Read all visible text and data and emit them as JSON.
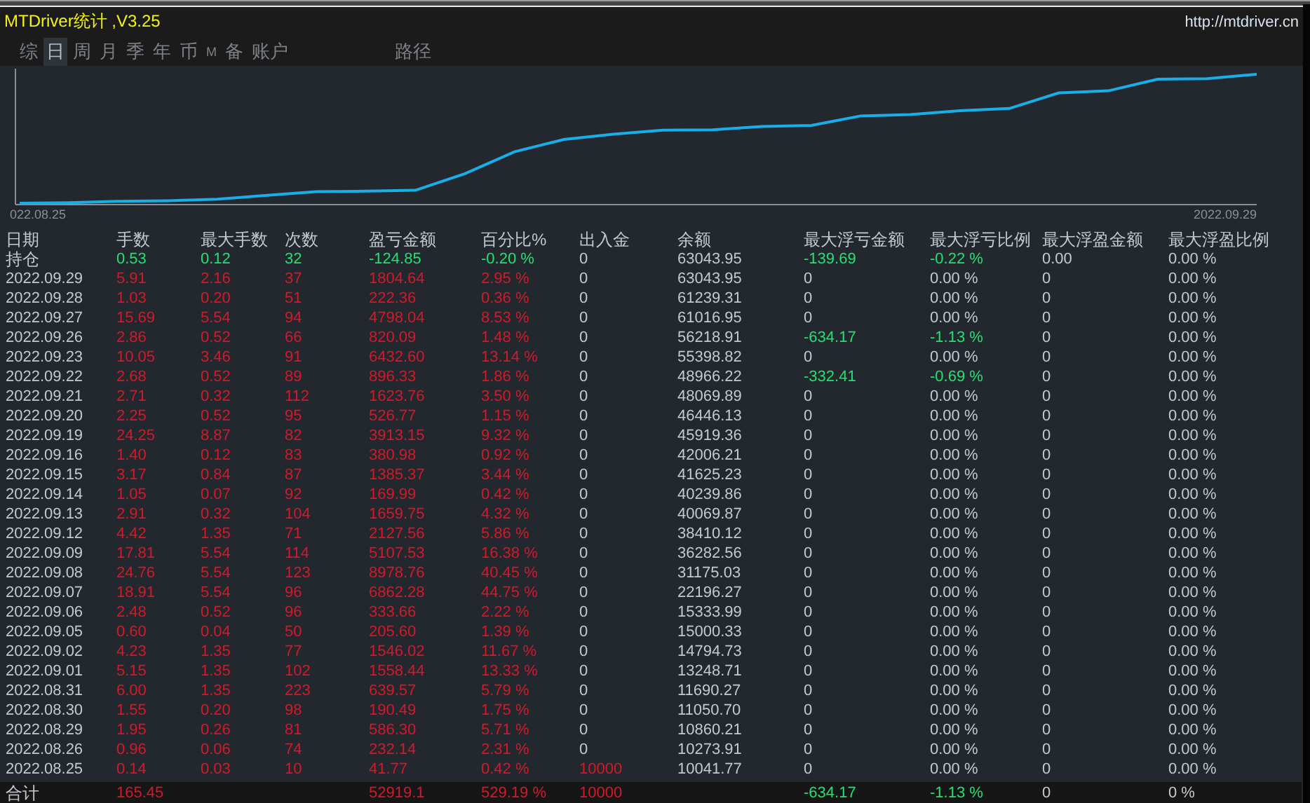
{
  "window": {
    "title": "MTDriver统计 ,V3.25",
    "url": "http://mtdriver.cn"
  },
  "tabs": [
    {
      "label": "综",
      "selected": false
    },
    {
      "label": "日",
      "selected": true
    },
    {
      "label": "周",
      "selected": false
    },
    {
      "label": "月",
      "selected": false
    },
    {
      "label": "季",
      "selected": false
    },
    {
      "label": "年",
      "selected": false
    },
    {
      "label": "币",
      "selected": false
    },
    {
      "label": "M",
      "selected": false,
      "kind": "small"
    },
    {
      "label": "备",
      "selected": false
    },
    {
      "label": "账户",
      "selected": false
    },
    {
      "label": "路径",
      "selected": false,
      "kind": "far"
    }
  ],
  "chart": {
    "start_label": "022.08.25",
    "end_label": "2022.09.29"
  },
  "table": {
    "columns": [
      "日期",
      "手数",
      "最大手数",
      "次数",
      "盈亏金额",
      "百分比%",
      "出入金",
      "余额",
      "最大浮亏金额",
      "最大浮亏比例",
      "最大浮盈金额",
      "最大浮盈比例"
    ],
    "holding": {
      "cells": [
        "持仓",
        "0.53",
        "0.12",
        "32",
        "-124.85",
        "-0.20 %",
        "0",
        "63043.95",
        "-139.69",
        "-0.22 %",
        "0.00",
        "0.00 %"
      ]
    },
    "rows": [
      {
        "cells": [
          "2022.09.29",
          "5.91",
          "2.16",
          "37",
          "1804.64",
          "2.95 %",
          "0",
          "63043.95",
          "0",
          "0.00 %",
          "0",
          "0.00 %"
        ],
        "drawdown": false,
        "deposit": false
      },
      {
        "cells": [
          "2022.09.28",
          "1.03",
          "0.20",
          "51",
          "222.36",
          "0.36 %",
          "0",
          "61239.31",
          "0",
          "0.00 %",
          "0",
          "0.00 %"
        ],
        "drawdown": false,
        "deposit": false
      },
      {
        "cells": [
          "2022.09.27",
          "15.69",
          "5.54",
          "94",
          "4798.04",
          "8.53 %",
          "0",
          "61016.95",
          "0",
          "0.00 %",
          "0",
          "0.00 %"
        ],
        "drawdown": false,
        "deposit": false
      },
      {
        "cells": [
          "2022.09.26",
          "2.86",
          "0.52",
          "66",
          "820.09",
          "1.48 %",
          "0",
          "56218.91",
          "-634.17",
          "-1.13 %",
          "0",
          "0.00 %"
        ],
        "drawdown": true,
        "deposit": false
      },
      {
        "cells": [
          "2022.09.23",
          "10.05",
          "3.46",
          "91",
          "6432.60",
          "13.14 %",
          "0",
          "55398.82",
          "0",
          "0.00 %",
          "0",
          "0.00 %"
        ],
        "drawdown": false,
        "deposit": false
      },
      {
        "cells": [
          "2022.09.22",
          "2.68",
          "0.52",
          "89",
          "896.33",
          "1.86 %",
          "0",
          "48966.22",
          "-332.41",
          "-0.69 %",
          "0",
          "0.00 %"
        ],
        "drawdown": true,
        "deposit": false
      },
      {
        "cells": [
          "2022.09.21",
          "2.71",
          "0.32",
          "112",
          "1623.76",
          "3.50 %",
          "0",
          "48069.89",
          "0",
          "0.00 %",
          "0",
          "0.00 %"
        ],
        "drawdown": false,
        "deposit": false
      },
      {
        "cells": [
          "2022.09.20",
          "2.25",
          "0.52",
          "95",
          "526.77",
          "1.15 %",
          "0",
          "46446.13",
          "0",
          "0.00 %",
          "0",
          "0.00 %"
        ],
        "drawdown": false,
        "deposit": false
      },
      {
        "cells": [
          "2022.09.19",
          "24.25",
          "8.87",
          "82",
          "3913.15",
          "9.32 %",
          "0",
          "45919.36",
          "0",
          "0.00 %",
          "0",
          "0.00 %"
        ],
        "drawdown": false,
        "deposit": false
      },
      {
        "cells": [
          "2022.09.16",
          "1.40",
          "0.12",
          "83",
          "380.98",
          "0.92 %",
          "0",
          "42006.21",
          "0",
          "0.00 %",
          "0",
          "0.00 %"
        ],
        "drawdown": false,
        "deposit": false
      },
      {
        "cells": [
          "2022.09.15",
          "3.17",
          "0.84",
          "87",
          "1385.37",
          "3.44 %",
          "0",
          "41625.23",
          "0",
          "0.00 %",
          "0",
          "0.00 %"
        ],
        "drawdown": false,
        "deposit": false
      },
      {
        "cells": [
          "2022.09.14",
          "1.05",
          "0.07",
          "92",
          "169.99",
          "0.42 %",
          "0",
          "40239.86",
          "0",
          "0.00 %",
          "0",
          "0.00 %"
        ],
        "drawdown": false,
        "deposit": false
      },
      {
        "cells": [
          "2022.09.13",
          "2.91",
          "0.32",
          "104",
          "1659.75",
          "4.32 %",
          "0",
          "40069.87",
          "0",
          "0.00 %",
          "0",
          "0.00 %"
        ],
        "drawdown": false,
        "deposit": false
      },
      {
        "cells": [
          "2022.09.12",
          "4.42",
          "1.35",
          "71",
          "2127.56",
          "5.86 %",
          "0",
          "38410.12",
          "0",
          "0.00 %",
          "0",
          "0.00 %"
        ],
        "drawdown": false,
        "deposit": false
      },
      {
        "cells": [
          "2022.09.09",
          "17.81",
          "5.54",
          "114",
          "5107.53",
          "16.38 %",
          "0",
          "36282.56",
          "0",
          "0.00 %",
          "0",
          "0.00 %"
        ],
        "drawdown": false,
        "deposit": false
      },
      {
        "cells": [
          "2022.09.08",
          "24.76",
          "5.54",
          "123",
          "8978.76",
          "40.45 %",
          "0",
          "31175.03",
          "0",
          "0.00 %",
          "0",
          "0.00 %"
        ],
        "drawdown": false,
        "deposit": false
      },
      {
        "cells": [
          "2022.09.07",
          "18.91",
          "5.54",
          "96",
          "6862.28",
          "44.75 %",
          "0",
          "22196.27",
          "0",
          "0.00 %",
          "0",
          "0.00 %"
        ],
        "drawdown": false,
        "deposit": false
      },
      {
        "cells": [
          "2022.09.06",
          "2.48",
          "0.52",
          "96",
          "333.66",
          "2.22 %",
          "0",
          "15333.99",
          "0",
          "0.00 %",
          "0",
          "0.00 %"
        ],
        "drawdown": false,
        "deposit": false
      },
      {
        "cells": [
          "2022.09.05",
          "0.60",
          "0.04",
          "50",
          "205.60",
          "1.39 %",
          "0",
          "15000.33",
          "0",
          "0.00 %",
          "0",
          "0.00 %"
        ],
        "drawdown": false,
        "deposit": false
      },
      {
        "cells": [
          "2022.09.02",
          "4.23",
          "1.35",
          "77",
          "1546.02",
          "11.67 %",
          "0",
          "14794.73",
          "0",
          "0.00 %",
          "0",
          "0.00 %"
        ],
        "drawdown": false,
        "deposit": false
      },
      {
        "cells": [
          "2022.09.01",
          "5.15",
          "1.35",
          "102",
          "1558.44",
          "13.33 %",
          "0",
          "13248.71",
          "0",
          "0.00 %",
          "0",
          "0.00 %"
        ],
        "drawdown": false,
        "deposit": false
      },
      {
        "cells": [
          "2022.08.31",
          "6.00",
          "1.35",
          "223",
          "639.57",
          "5.79 %",
          "0",
          "11690.27",
          "0",
          "0.00 %",
          "0",
          "0.00 %"
        ],
        "drawdown": false,
        "deposit": false
      },
      {
        "cells": [
          "2022.08.30",
          "1.55",
          "0.20",
          "98",
          "190.49",
          "1.75 %",
          "0",
          "11050.70",
          "0",
          "0.00 %",
          "0",
          "0.00 %"
        ],
        "drawdown": false,
        "deposit": false
      },
      {
        "cells": [
          "2022.08.29",
          "1.95",
          "0.26",
          "81",
          "586.30",
          "5.71 %",
          "0",
          "10860.21",
          "0",
          "0.00 %",
          "0",
          "0.00 %"
        ],
        "drawdown": false,
        "deposit": false
      },
      {
        "cells": [
          "2022.08.26",
          "0.96",
          "0.06",
          "74",
          "232.14",
          "2.31 %",
          "0",
          "10273.91",
          "0",
          "0.00 %",
          "0",
          "0.00 %"
        ],
        "drawdown": false,
        "deposit": false
      },
      {
        "cells": [
          "2022.08.25",
          "0.14",
          "0.03",
          "10",
          "41.77",
          "0.42 %",
          "10000",
          "10041.77",
          "0",
          "0.00 %",
          "0",
          "0.00 %"
        ],
        "drawdown": false,
        "deposit": true
      }
    ],
    "total": {
      "cells": [
        "合计",
        "165.45",
        "",
        "",
        "52919.1",
        "529.19 %",
        "10000",
        "",
        "-634.17",
        "-1.13 %",
        "0",
        "0 %"
      ]
    }
  }
}
